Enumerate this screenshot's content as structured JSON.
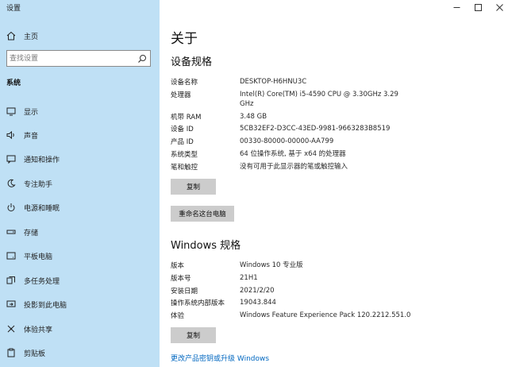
{
  "window": {
    "title": "设置"
  },
  "sidebar": {
    "home_label": "主页",
    "search_placeholder": "查找设置",
    "section": "系统",
    "items": [
      {
        "label": "显示",
        "icon": "display-icon"
      },
      {
        "label": "声音",
        "icon": "speaker-icon"
      },
      {
        "label": "通知和操作",
        "icon": "notification-icon"
      },
      {
        "label": "专注助手",
        "icon": "moon-icon"
      },
      {
        "label": "电源和睡眠",
        "icon": "power-icon"
      },
      {
        "label": "存储",
        "icon": "storage-icon"
      },
      {
        "label": "平板电脑",
        "icon": "tablet-icon"
      },
      {
        "label": "多任务处理",
        "icon": "multitask-icon"
      },
      {
        "label": "投影到此电脑",
        "icon": "project-icon"
      },
      {
        "label": "体验共享",
        "icon": "share-icon"
      },
      {
        "label": "剪贴板",
        "icon": "clipboard-icon"
      }
    ]
  },
  "main": {
    "title": "关于",
    "device_heading": "设备规格",
    "device_specs": [
      {
        "key": "设备名称",
        "value": "DESKTOP-H6HNU3C"
      },
      {
        "key": "处理器",
        "value": "Intel(R) Core(TM) i5-4590 CPU @ 3.30GHz   3.29 GHz"
      },
      {
        "key": "机带 RAM",
        "value": "3.48 GB"
      },
      {
        "key": "设备 ID",
        "value": "5CB32EF2-D3CC-43ED-9981-9663283B8519"
      },
      {
        "key": "产品 ID",
        "value": "00330-80000-00000-AA799"
      },
      {
        "key": "系统类型",
        "value": "64 位操作系统, 基于 x64 的处理器"
      },
      {
        "key": "笔和触控",
        "value": "没有可用于此显示器的笔或触控输入"
      }
    ],
    "copy_label": "复制",
    "rename_label": "重命名这台电脑",
    "windows_heading": "Windows 规格",
    "windows_specs": [
      {
        "key": "版本",
        "value": "Windows 10 专业版"
      },
      {
        "key": "版本号",
        "value": "21H1"
      },
      {
        "key": "安装日期",
        "value": "2021/2/20"
      },
      {
        "key": "操作系统内部版本",
        "value": "19043.844"
      },
      {
        "key": "体验",
        "value": "Windows Feature Experience Pack 120.2212.551.0"
      }
    ],
    "copy_label_2": "复制",
    "link_label": "更改产品密钥或升级 Windows"
  }
}
